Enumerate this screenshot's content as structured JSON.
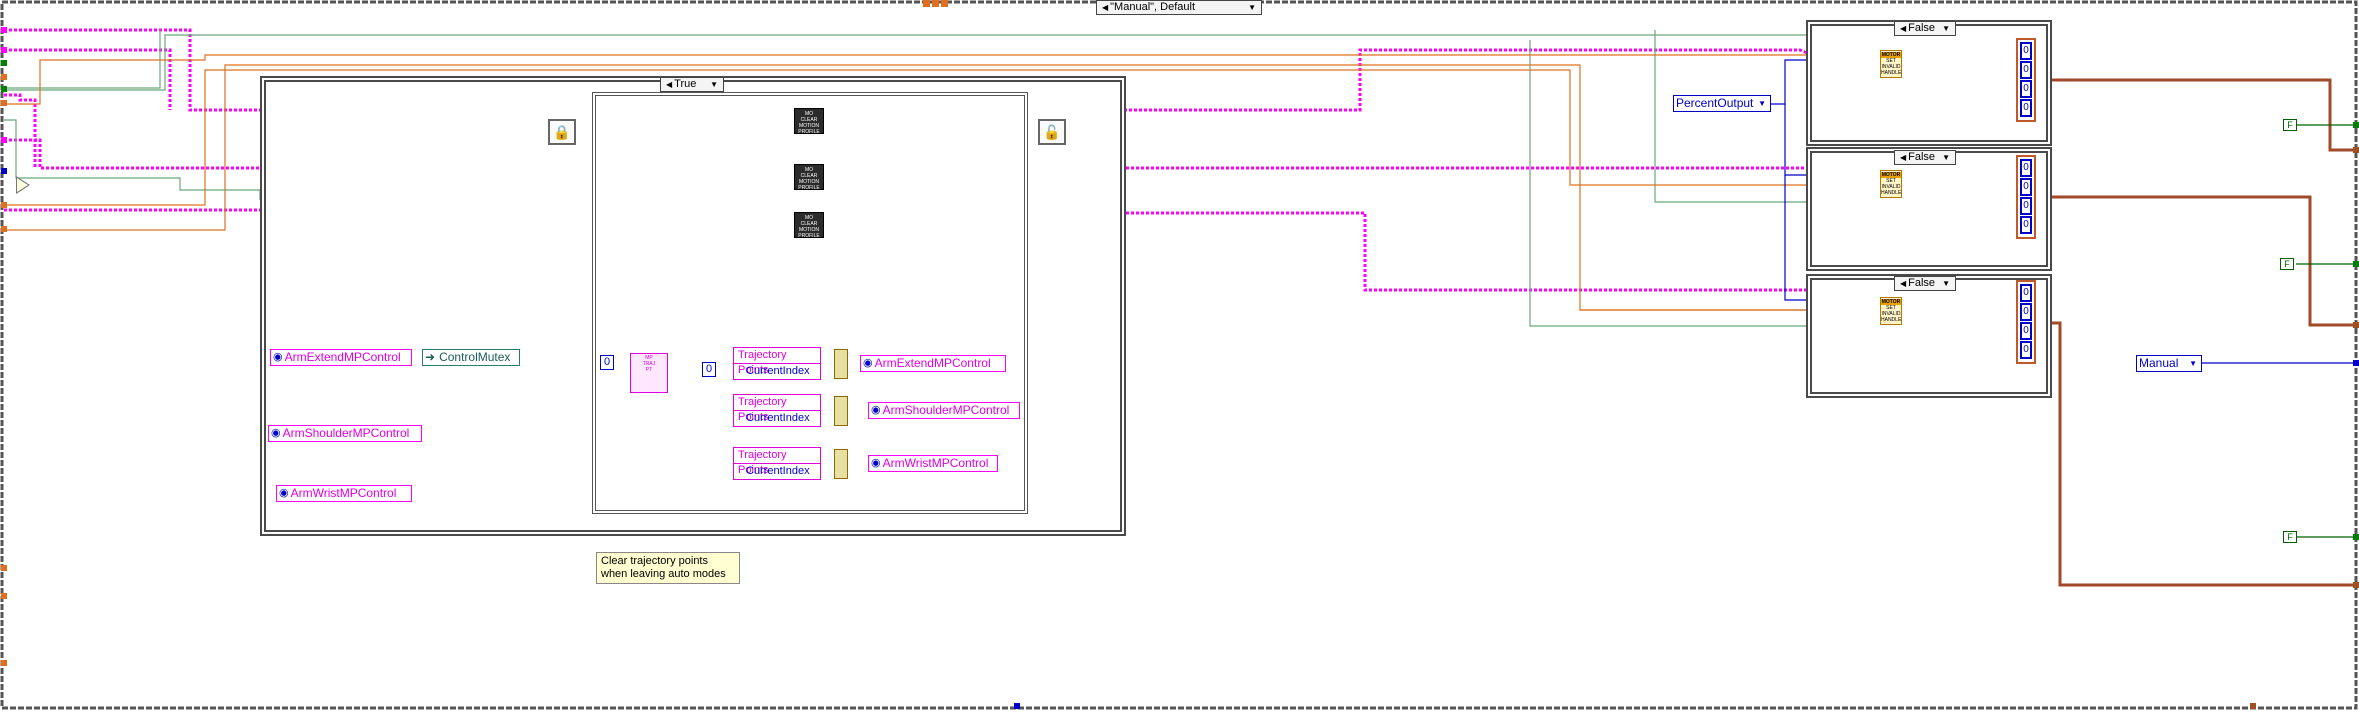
{
  "top_case_selector": {
    "label": "\"Manual\", Default"
  },
  "inner_case_selector": {
    "label": "True"
  },
  "right_case_selectors": [
    {
      "label": "False"
    },
    {
      "label": "False"
    },
    {
      "label": "False"
    }
  ],
  "controls": {
    "arm_extend_mp_control_in": "ArmExtendMPControl",
    "arm_shoulder_mp_control_in": "ArmShoulderMPControl",
    "arm_wrist_mp_control_in": "ArmWristMPControl",
    "control_mutex": "ControlMutex",
    "arm_extend_mp_control_out": "ArmExtendMPControl",
    "arm_shoulder_mp_control_out": "ArmShoulderMPControl",
    "arm_wrist_mp_control_out": "ArmWristMPControl",
    "percent_output": "PercentOutput",
    "manual_enum": "Manual"
  },
  "clusters": [
    {
      "row1": "Trajectory Points",
      "row2": "CurrentIndex"
    },
    {
      "row1": "Trajectory Points",
      "row2": "CurrentIndex"
    },
    {
      "row1": "Trajectory Points",
      "row2": "CurrentIndex"
    }
  ],
  "mp_nodes": [
    {
      "line1": "MO",
      "line2": "CLEAR",
      "line3": "MOTION",
      "line4": "PROFILE"
    },
    {
      "line1": "MO",
      "line2": "CLEAR",
      "line3": "MOTION",
      "line4": "PROFILE"
    },
    {
      "line1": "MO",
      "line2": "CLEAR",
      "line3": "MOTION",
      "line4": "PROFILE"
    }
  ],
  "motor_nodes": [
    {
      "hdr": "MOTOR",
      "line1": "SET",
      "line2": "INVALID",
      "line3": "HANDLE"
    },
    {
      "hdr": "MOTOR",
      "line1": "SET",
      "line2": "INVALID",
      "line3": "HANDLE"
    },
    {
      "hdr": "MOTOR",
      "line1": "SET",
      "line2": "INVALID",
      "line3": "HANDLE"
    }
  ],
  "numeric_constants": {
    "zero_a": "0",
    "zero_b": "0"
  },
  "array_values": [
    "0",
    "0",
    "0",
    "0"
  ],
  "traj_node": {
    "line1": "MP",
    "line2": "TRAJ",
    "line3": "PT"
  },
  "bool_constants": [
    "F",
    "F",
    "F"
  ],
  "comment": "Clear trajectory points\nwhen leaving auto modes",
  "icons": {
    "lock_acquire": "lock-acquire-icon",
    "lock_release": "lock-release-icon",
    "global_variable": "globe-icon"
  },
  "colors": {
    "refnum_wire": "#ff00ff",
    "number_wire": "#0000c8",
    "orange_wire": "#e07020",
    "green_wire": "#6aa87a",
    "brown_wire": "#a04a2a",
    "teal_wire": "#2a7b6e",
    "comment_bg": "#ffffd2"
  }
}
